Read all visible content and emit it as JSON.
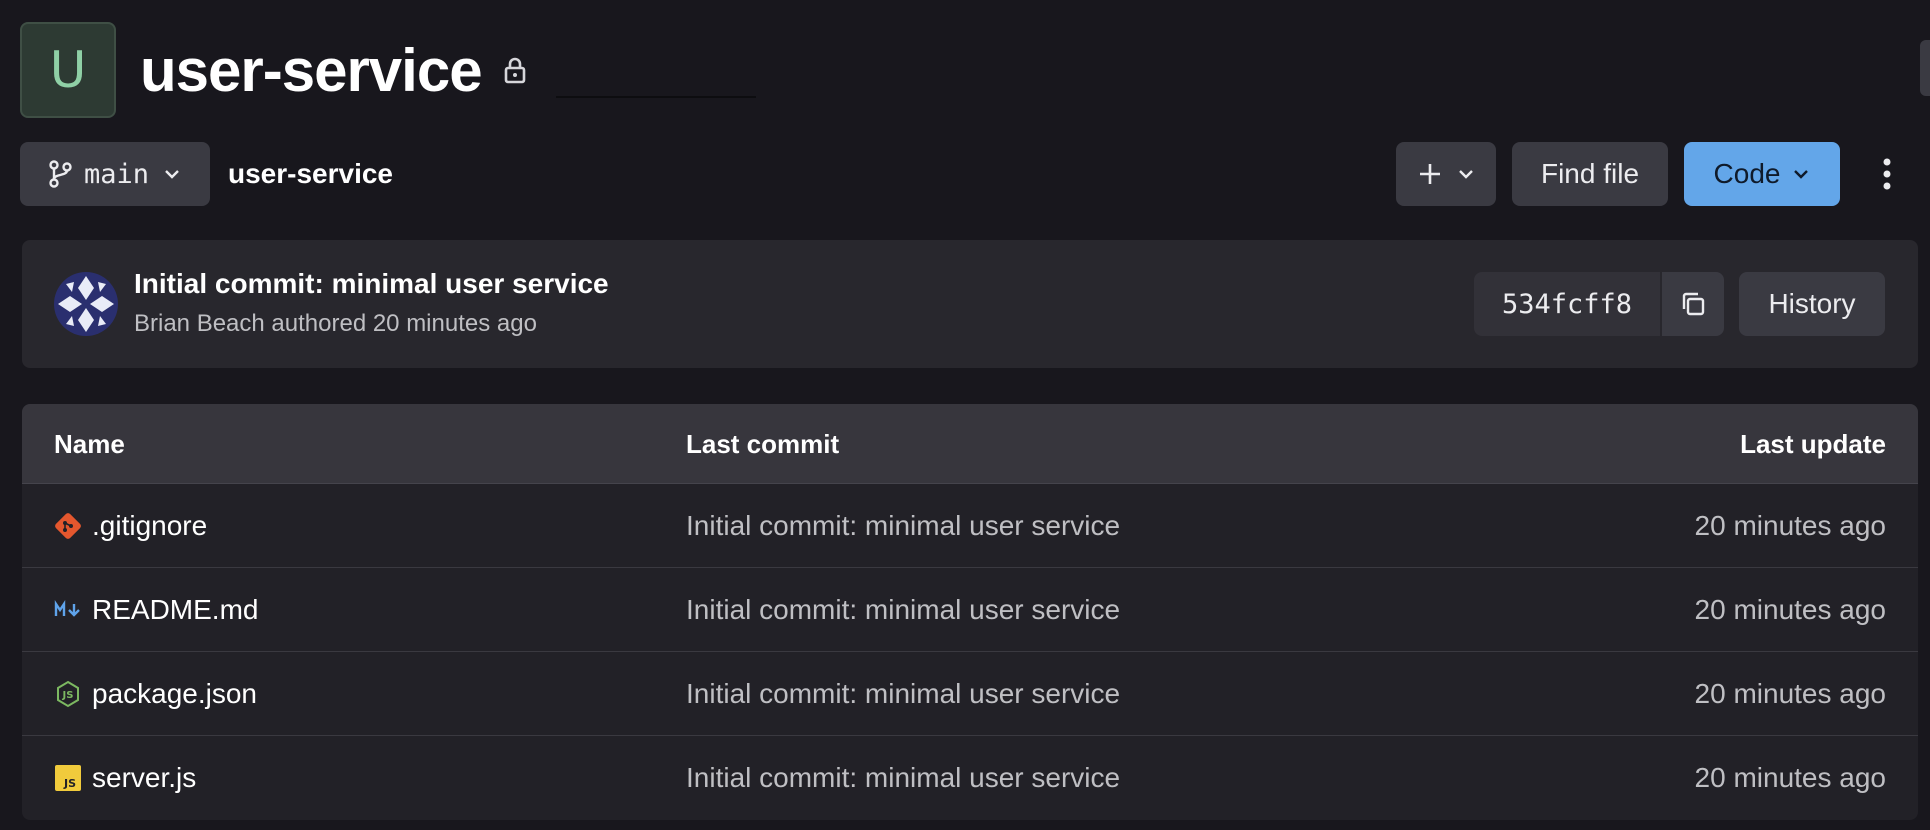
{
  "project": {
    "avatar_letter": "U",
    "name": "user-service"
  },
  "toolbar": {
    "branch": "main",
    "breadcrumb": "user-service",
    "find_file_label": "Find file",
    "code_label": "Code"
  },
  "last_commit": {
    "title": "Initial commit: minimal user service",
    "meta": "Brian Beach authored 20 minutes ago",
    "sha": "534fcff8",
    "history_label": "History"
  },
  "table": {
    "headers": {
      "name": "Name",
      "last_commit": "Last commit",
      "last_update": "Last update"
    },
    "rows": [
      {
        "name": ".gitignore",
        "icon": "git-icon",
        "commit": "Initial commit: minimal user service",
        "updated": "20 minutes ago"
      },
      {
        "name": "README.md",
        "icon": "markdown-icon",
        "commit": "Initial commit: minimal user service",
        "updated": "20 minutes ago"
      },
      {
        "name": "package.json",
        "icon": "nodejs-icon",
        "commit": "Initial commit: minimal user service",
        "updated": "20 minutes ago"
      },
      {
        "name": "server.js",
        "icon": "javascript-icon",
        "commit": "Initial commit: minimal user service",
        "updated": "20 minutes ago"
      }
    ]
  },
  "colors": {
    "background": "#18171d",
    "primary_button": "#63a6e9",
    "avatar_text": "#8fd0a6"
  }
}
